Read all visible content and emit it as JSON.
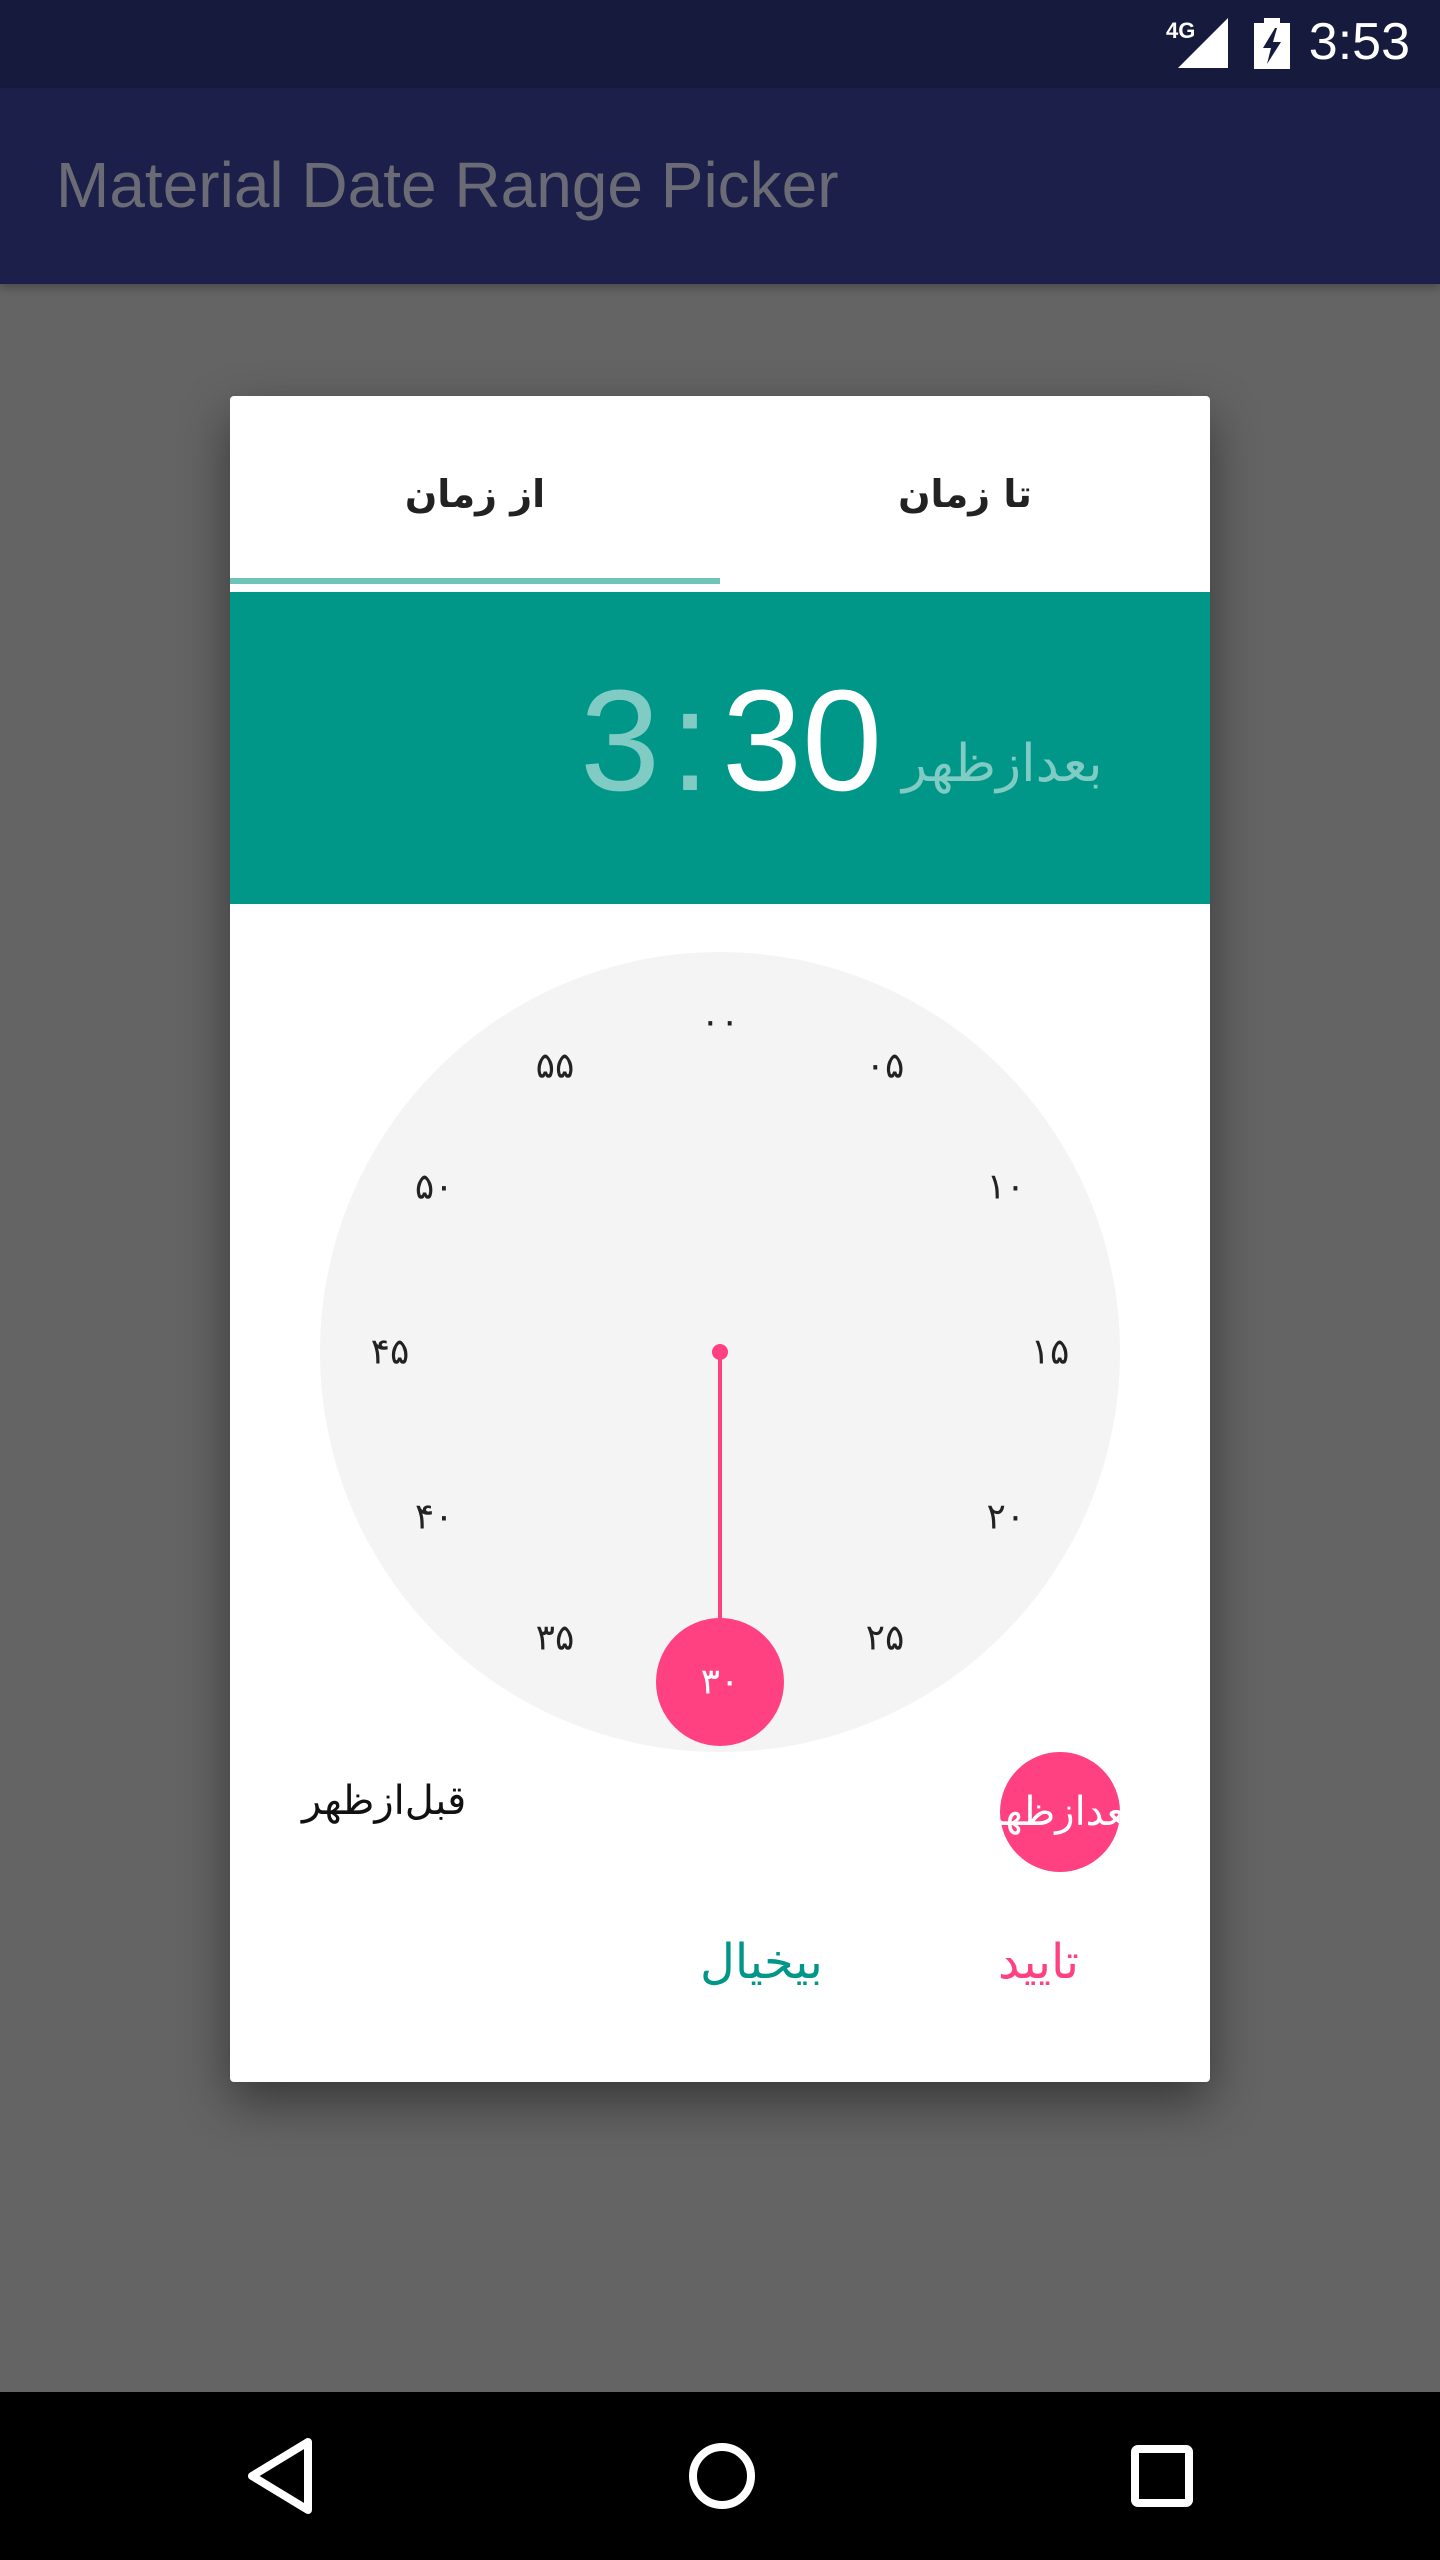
{
  "status_bar": {
    "network": "4G",
    "time": "3:53"
  },
  "app_bar": {
    "title": "Material Date Range Picker"
  },
  "dialog": {
    "tabs": [
      {
        "label": "تا زمان"
      },
      {
        "label": "از زمان"
      }
    ],
    "time": {
      "hour": "3",
      "separator": ":",
      "minute": "30",
      "ampm": "بعدازظهر"
    },
    "clock": {
      "labels": [
        "۰۰",
        "۰۵",
        "۱۰",
        "۱۵",
        "۲۰",
        "۲۵",
        "۳۰",
        "۳۵",
        "۴۰",
        "۴۵",
        "۵۰",
        "۵۵"
      ],
      "selected_label": "۳۰",
      "selected_value": 30,
      "hand_color": "#ff4081",
      "face_color": "#f4f4f4"
    },
    "ampm": {
      "am_label": "قبل‌ازظهر",
      "pm_label": "بعدازظهر",
      "selected": "pm"
    },
    "buttons": {
      "cancel": "بیخیال",
      "ok": "تایید"
    },
    "colors": {
      "header": "#009688",
      "accent": "#ff4081"
    }
  },
  "nav_bar": {
    "icons": [
      "back-icon",
      "home-icon",
      "recents-icon"
    ]
  }
}
